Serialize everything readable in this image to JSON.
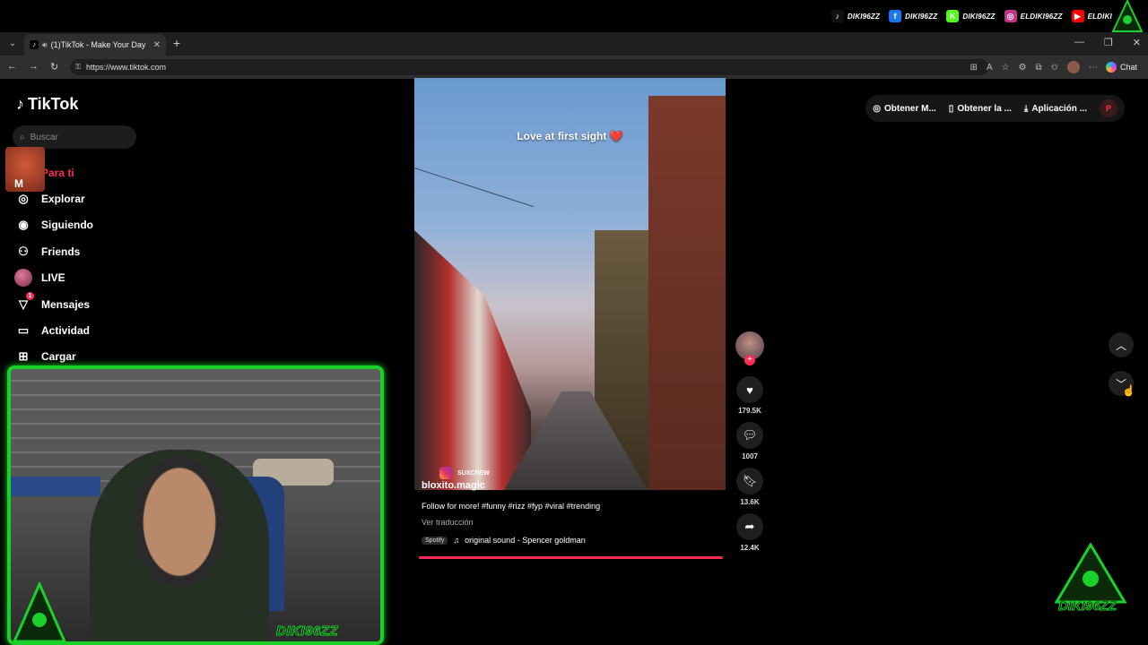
{
  "overlay": {
    "socials": [
      {
        "icon": "tiktok-icon",
        "handle": "DIKI96ZZ",
        "color": "#111111",
        "glyph": "♪"
      },
      {
        "icon": "facebook-icon",
        "handle": "DIKI96ZZ",
        "color": "#1877f2",
        "glyph": "f"
      },
      {
        "icon": "kick-icon",
        "handle": "DIKI96ZZ",
        "color": "#53fc18",
        "glyph": "K"
      },
      {
        "icon": "instagram-icon",
        "handle": "ELDIKI96ZZ",
        "color": "#c13584",
        "glyph": "◎"
      },
      {
        "icon": "youtube-icon",
        "handle": "ELDIKI",
        "color": "#ff0000",
        "glyph": "▶"
      }
    ],
    "streamer_name": "DIKI96ZZ",
    "brand_color": "#1bd02a"
  },
  "browser": {
    "tab_title": "(1)TikTok - Make Your Day",
    "url": "https://www.tiktok.com",
    "chat_label": "Chat"
  },
  "tiktok": {
    "logo": "TikTok",
    "search_placeholder": "Buscar",
    "nav": [
      {
        "name": "nav-para-ti",
        "icon": "home-icon",
        "glyph": "⌂",
        "label": "Para ti",
        "active": true
      },
      {
        "name": "nav-explorar",
        "icon": "compass-icon",
        "glyph": "◎",
        "label": "Explorar"
      },
      {
        "name": "nav-siguiendo",
        "icon": "following-icon",
        "glyph": "◉",
        "label": "Siguiendo"
      },
      {
        "name": "nav-friends",
        "icon": "friends-icon",
        "glyph": "⚇",
        "label": "Friends"
      },
      {
        "name": "nav-live",
        "icon": "live-icon",
        "glyph": "",
        "label": "LIVE"
      },
      {
        "name": "nav-mensajes",
        "icon": "messages-icon",
        "glyph": "▽",
        "label": "Mensajes",
        "badge": "1"
      },
      {
        "name": "nav-actividad",
        "icon": "activity-icon",
        "glyph": "▭",
        "label": "Actividad"
      },
      {
        "name": "nav-cargar",
        "icon": "upload-icon",
        "glyph": "⊞",
        "label": "Cargar"
      }
    ],
    "top_actions": [
      {
        "icon": "coin-icon",
        "glyph": "◎",
        "label": "Obtener M..."
      },
      {
        "icon": "phone-icon",
        "glyph": "▯",
        "label": "Obtener la ..."
      },
      {
        "icon": "download-icon",
        "glyph": "⤓",
        "label": "Aplicación ..."
      }
    ],
    "profile_initial": "P",
    "video": {
      "caption": "Love at first sight ❤️",
      "watermark": "SUXCREW",
      "author": "bloxito.magic",
      "description": "Follow for more! #funny #rizz #fyp #viral #trending",
      "translate": "Ver traducción",
      "music_badge": "Spotify",
      "sound": "original sound - Spencer goldman",
      "progress_percent": 100
    },
    "stats": {
      "likes": "179.5K",
      "comments": "1007",
      "saves": "13.6K",
      "shares": "12.4K"
    },
    "accent": "#fe2c55"
  }
}
